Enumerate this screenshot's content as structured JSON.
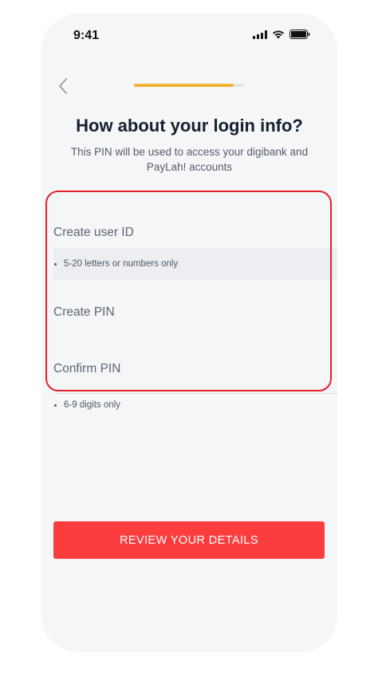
{
  "status_bar": {
    "time": "9:41"
  },
  "header": {
    "progress_fraction": 0.9
  },
  "title": "How about your login info?",
  "subtitle": "This PIN will be used to access your digibank and PayLah! accounts",
  "form": {
    "user_id_placeholder": "Create user ID",
    "user_id_hint": "5-20 letters or numbers only",
    "pin_placeholder": "Create PIN",
    "confirm_pin_placeholder": "Confirm PIN",
    "pin_hint": "6-9 digits only"
  },
  "actions": {
    "review_label": "REVIEW YOUR DETAILS"
  },
  "colors": {
    "accent": "#fb3d3d",
    "progress": "#f2b233",
    "highlight": "#e4202c"
  },
  "icons": {
    "back": "chevron-left-icon",
    "signal": "signal-icon",
    "wifi": "wifi-icon",
    "battery": "battery-icon"
  }
}
